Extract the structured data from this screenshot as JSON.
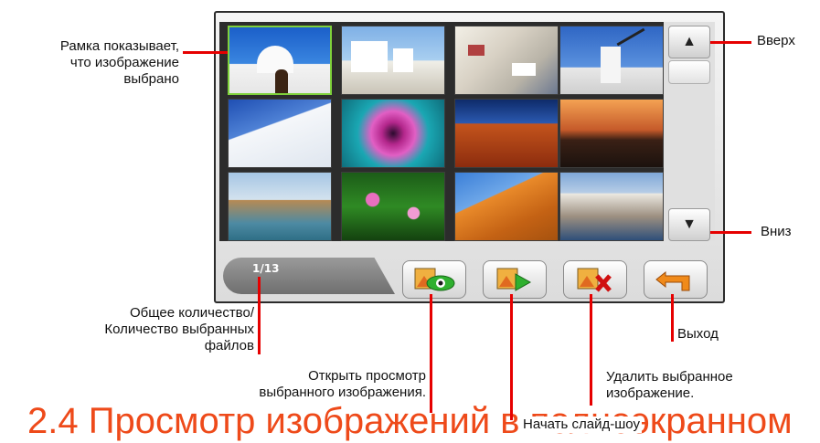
{
  "counter": "1/13",
  "callouts": {
    "frame_selected": [
      "Рамка показывает,",
      "что изображение",
      "выбрано"
    ],
    "up": "Вверх",
    "down": "Вниз",
    "total_count": [
      "Общее количество/",
      "Количество выбранных",
      "файлов"
    ],
    "open_view": [
      "Открыть просмотр",
      "выбранного изображения."
    ],
    "slideshow": "Начать слайд-шоу",
    "delete": [
      "Удалить выбранное",
      "изображение."
    ],
    "exit": "Выход"
  },
  "heading": "2.4    Просмотр изображений в полноэкранном",
  "thumbnails": [
    {
      "name": "white-church-thumb",
      "selected": true
    },
    {
      "name": "church-coast-thumb",
      "selected": false
    },
    {
      "name": "hillside-town-thumb",
      "selected": false
    },
    {
      "name": "windmill-thumb",
      "selected": false
    },
    {
      "name": "snowy-slope-thumb",
      "selected": false
    },
    {
      "name": "purple-flower-thumb",
      "selected": false
    },
    {
      "name": "red-desert-thumb",
      "selected": false
    },
    {
      "name": "sunset-harbor-thumb",
      "selected": false
    },
    {
      "name": "venice-canal-thumb",
      "selected": false
    },
    {
      "name": "lily-pads-thumb",
      "selected": false
    },
    {
      "name": "sand-dune-thumb",
      "selected": false
    },
    {
      "name": "cliff-village-thumb",
      "selected": false
    }
  ],
  "icons": {
    "up": "up-arrow-icon",
    "down": "down-arrow-icon",
    "view": "view-image-icon",
    "slideshow": "slideshow-play-icon",
    "delete": "delete-image-icon",
    "exit": "back-arrow-icon"
  },
  "colors": {
    "selection": "#7fd13b",
    "callout_line": "#e60000",
    "heading": "#ee4a1a"
  }
}
